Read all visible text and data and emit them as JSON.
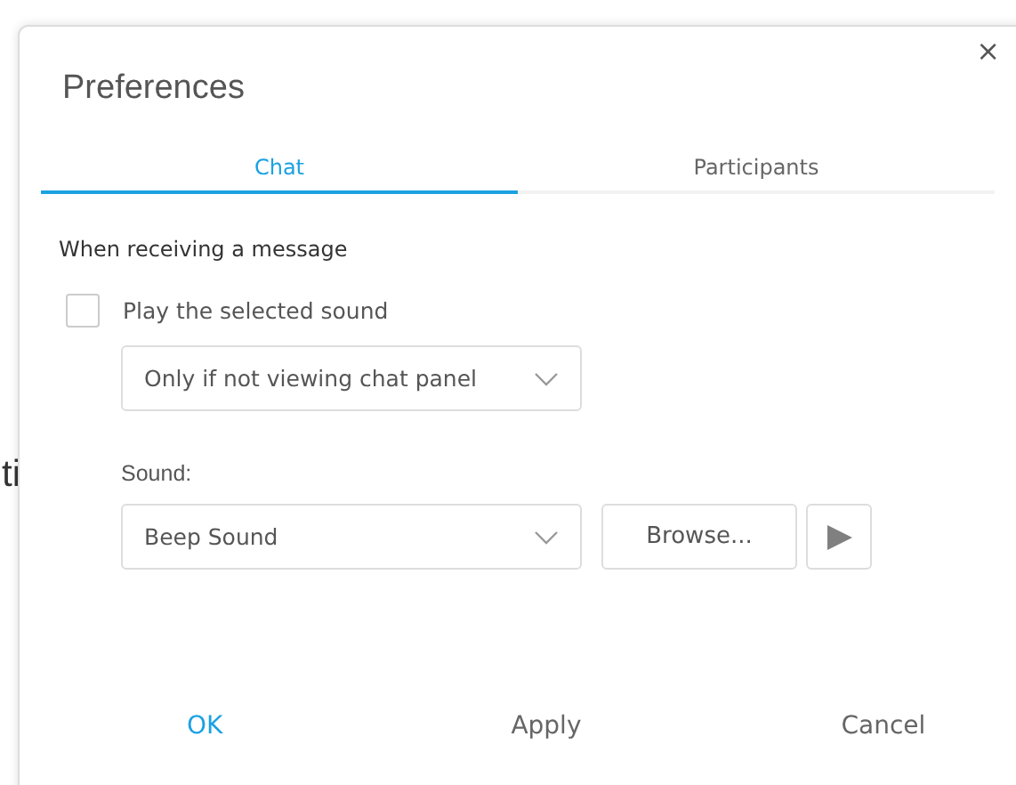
{
  "background_text": "ti",
  "dialog": {
    "title": "Preferences",
    "close": "×"
  },
  "tabs": [
    {
      "label": "Chat",
      "selected": true
    },
    {
      "label": "Participants",
      "selected": false
    }
  ],
  "section_label": "When receiving a message",
  "play_sound": {
    "label": "Play the selected sound",
    "checked": false
  },
  "condition_select": {
    "value": "Only if not viewing chat panel"
  },
  "sound_label": "Sound:",
  "sound_select": {
    "value": "Beep Sound"
  },
  "browse_button": "Browse...",
  "buttons": [
    {
      "label": "OK",
      "primary": true
    },
    {
      "label": "Apply",
      "primary": false
    },
    {
      "label": "Cancel",
      "primary": false
    }
  ]
}
